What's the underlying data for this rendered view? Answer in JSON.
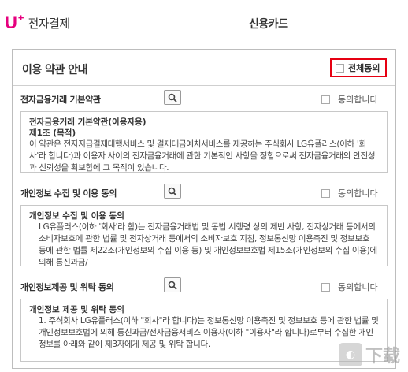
{
  "header": {
    "brand_u": "U",
    "brand_plus": "+",
    "brand_text": "전자결제",
    "page_title": "신용카드"
  },
  "terms_header": {
    "title": "이용 약관 안내",
    "all_agree_label": "전체동의"
  },
  "sections": [
    {
      "title": "전자금융거래 기본약관",
      "agree_label": "동의합니다",
      "box_title": "전자금융거래 기본약관(이용자용)",
      "box_subtitle": "제1조 (목적)",
      "box_body": "이 약관은 전자지급결제대행서비스 및 결제대금예치서비스를 제공하는 주식회사 LG유플러스(이하 '회사'라 합니다)과 이용자 사이의 전자금융거래에 관한 기본적인 사항을 정함으로써 전자금융거래의 안전성과 신뢰성을 확보함에 그 목적이 있습니다."
    },
    {
      "title": "개인정보 수집 및 이용 동의",
      "agree_label": "동의합니다",
      "box_title": "개인정보 수집 및 이용 동의",
      "box_body": "LG유플러스(이하 '회사'라 함)는 전자금융거래법 및 동법 시행령 상의 제반 사항, 전자상거래 등에서의 소비자보호에 관한 법률 및 전자상거래 등에서의 소비자보호 지침, 정보통신망 이용촉진 및 정보보호 등에 관한 법률 제22조(개인정보의 수집 이용 등) 및 개인정보보호법 제15조(개인정보의 수집 이용)에 의해 통신과금/"
    },
    {
      "title": "개인정보제공 및 위탁 동의",
      "agree_label": "동의합니다",
      "box_title": "개인정보 제공 및 위탁 동의",
      "box_body": "1. 주식회사 LG유플러스(이하 \"회사\"라 합니다)는 정보통신망 이용촉진 및 정보보호 등에 관한 법률 및 개인정보보호법에 의해 통신과금/전자금융서비스 이용자(이하 \"이용자\"라 합니다)로부터 수집한 개인정보를 아래와 같이 제3자에게 제공 및 위탁 합니다."
    }
  ],
  "icons": {
    "search": "search-icon"
  },
  "colors": {
    "brand": "#e6007e",
    "highlight_border": "#e60012"
  }
}
